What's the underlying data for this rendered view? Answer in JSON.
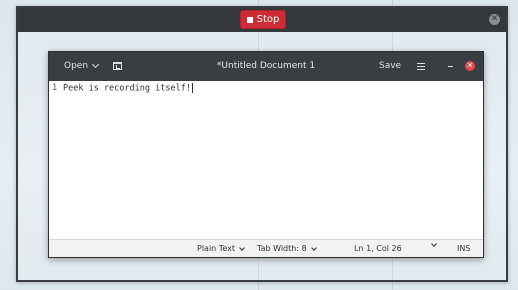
{
  "recorder": {
    "stop_label": "Stop",
    "close_symbol": "✕"
  },
  "editor_window": {
    "header": {
      "open_label": "Open",
      "title": "*Untitled Document 1",
      "save_label": "Save",
      "close_symbol": "✕"
    },
    "content": {
      "line_number": "1",
      "line_text": "Peek is recording itself!"
    },
    "statusbar": {
      "language": "Plain Text",
      "tab_width": "Tab Width: 8",
      "cursor_position": "Ln 1, Col 26",
      "insert_mode": "INS"
    }
  },
  "colors": {
    "stop_button": "#cd2b35",
    "close_button": "#e5474b",
    "headerbar": "#3a3e42"
  }
}
